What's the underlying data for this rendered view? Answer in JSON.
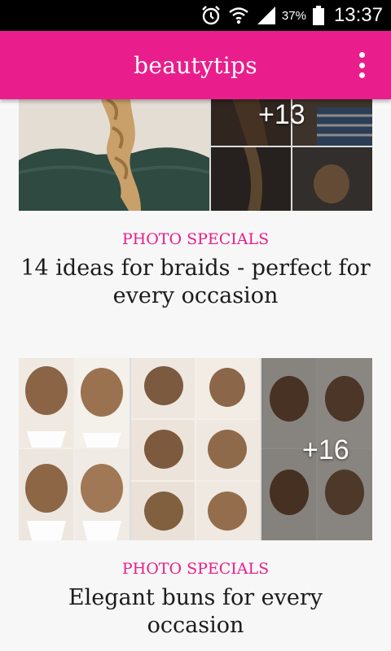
{
  "status_bar": {
    "battery_percent": "37%",
    "time": "13:37"
  },
  "app_bar": {
    "title": "beautytips"
  },
  "articles": [
    {
      "category": "PHOTO SPECIALS",
      "title": "14 ideas for braids - perfect for every occasion",
      "photo_count": "+13"
    },
    {
      "category": "PHOTO SPECIALS",
      "title": "Elegant buns for every occasion",
      "photo_count": "+16"
    }
  ],
  "colors": {
    "accent": "#e91e8c",
    "status_bar": "#000000",
    "background": "#f7f7f7",
    "text": "#1b1b1b"
  }
}
